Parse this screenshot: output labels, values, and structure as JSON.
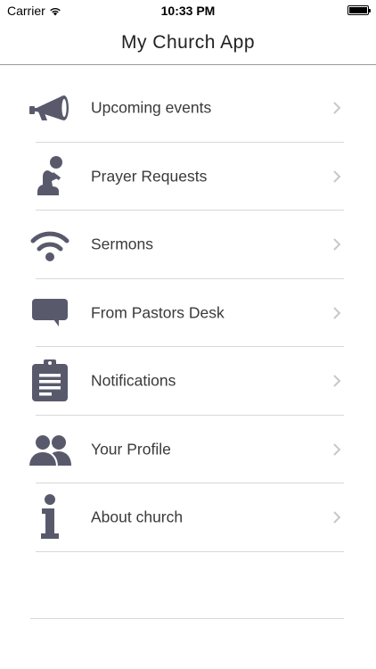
{
  "status_bar": {
    "carrier": "Carrier",
    "time": "10:33 PM",
    "icons": [
      "wifi-icon",
      "battery-icon"
    ]
  },
  "nav": {
    "title": "My Church App"
  },
  "menu": {
    "icon_color": "#585a6c",
    "chevron_color": "#c7c7cc",
    "items": [
      {
        "label": "Upcoming events",
        "icon": "megaphone-icon"
      },
      {
        "label": "Prayer Requests",
        "icon": "praying-person-icon"
      },
      {
        "label": "Sermons",
        "icon": "wifi-broadcast-icon"
      },
      {
        "label": "From Pastors Desk",
        "icon": "speech-bubble-icon"
      },
      {
        "label": "Notifications",
        "icon": "clipboard-icon"
      },
      {
        "label": "Your Profile",
        "icon": "users-icon"
      },
      {
        "label": "About church",
        "icon": "info-icon"
      }
    ]
  }
}
